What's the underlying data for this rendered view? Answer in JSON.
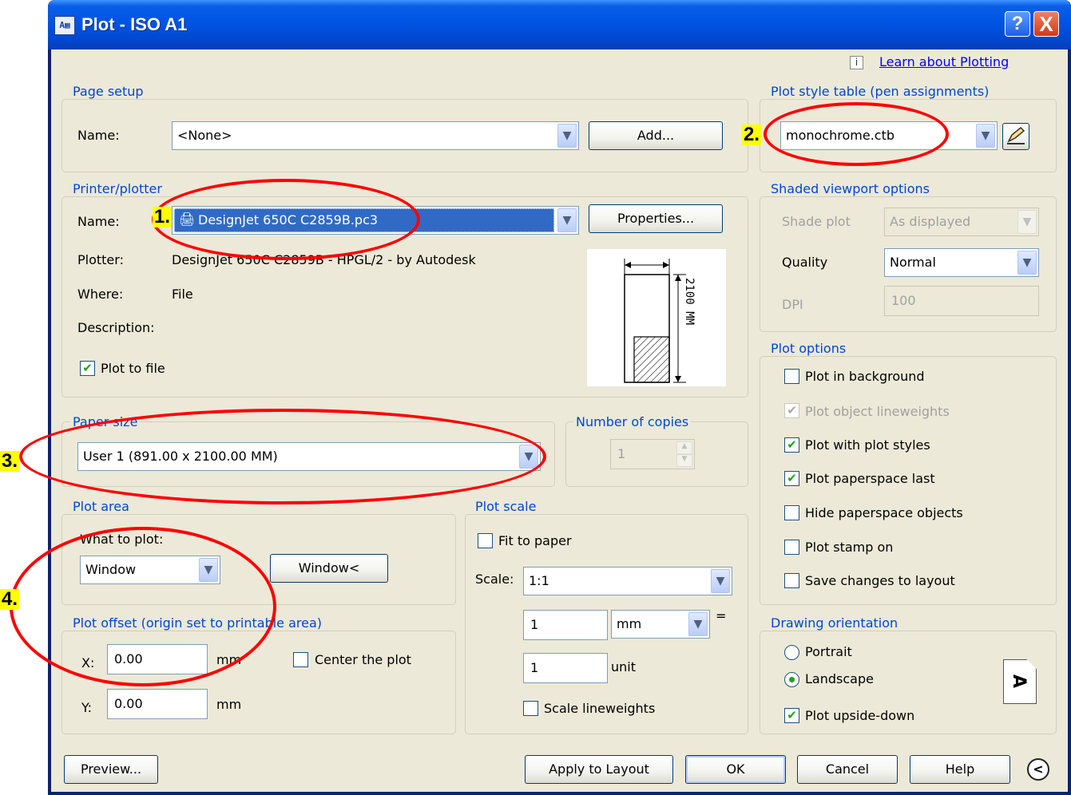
{
  "window": {
    "title": "Plot - ISO A1",
    "help_btn": "?",
    "close_btn": "X",
    "app_icon": "plot-icon"
  },
  "learn": {
    "info_glyph": "i",
    "link": "Learn about Plotting"
  },
  "page_setup": {
    "title": "Page setup",
    "name_label": "Name:",
    "name_value": "<None>",
    "add_button": "Add..."
  },
  "plot_style": {
    "title": "Plot style table (pen assignments)",
    "value": "monochrome.ctb"
  },
  "printer": {
    "title": "Printer/plotter",
    "name_label": "Name:",
    "name_value": "DesignJet 650C C2859B.pc3",
    "properties_button": "Properties...",
    "plotter_label": "Plotter:",
    "plotter_value": "DesignJet 650C C2859B - HPGL/2 - by Autodesk",
    "where_label": "Where:",
    "where_value": "File",
    "description_label": "Description:",
    "plot_to_file": "Plot to file",
    "plot_to_file_checked": true,
    "preview_dimension": "2100 MM"
  },
  "shaded": {
    "title": "Shaded viewport options",
    "shade_plot_label": "Shade plot",
    "shade_plot_value": "As displayed",
    "quality_label": "Quality",
    "quality_value": "Normal",
    "dpi_label": "DPI",
    "dpi_value": "100"
  },
  "plot_options": {
    "title": "Plot options",
    "items": [
      {
        "label": "Plot in background",
        "checked": false,
        "enabled": true
      },
      {
        "label": "Plot object lineweights",
        "checked": true,
        "enabled": false
      },
      {
        "label": "Plot with plot styles",
        "checked": true,
        "enabled": true
      },
      {
        "label": "Plot paperspace last",
        "checked": true,
        "enabled": true
      },
      {
        "label": "Hide paperspace objects",
        "checked": false,
        "enabled": true
      },
      {
        "label": "Plot stamp on",
        "checked": false,
        "enabled": true
      },
      {
        "label": "Save changes to layout",
        "checked": false,
        "enabled": true
      }
    ]
  },
  "paper_size": {
    "title": "Paper size",
    "value": "User 1 (891.00 x 2100.00 MM)"
  },
  "copies": {
    "title": "Number of copies",
    "value": "1"
  },
  "plot_area": {
    "title": "Plot area",
    "what_label": "What to plot:",
    "what_value": "Window",
    "window_button": "Window<"
  },
  "plot_offset": {
    "title": "Plot offset (origin set to printable area)",
    "x_label": "X:",
    "x_value": "0.00",
    "y_label": "Y:",
    "y_value": "0.00",
    "unit": "mm",
    "center_label": "Center the plot"
  },
  "plot_scale": {
    "title": "Plot scale",
    "fit_label": "Fit to paper",
    "scale_label": "Scale:",
    "scale_value": "1:1",
    "value1": "1",
    "unit1": "mm",
    "equals": "=",
    "value2": "1",
    "unit2": "unit",
    "lineweights_label": "Scale lineweights"
  },
  "orientation": {
    "title": "Drawing orientation",
    "portrait": "Portrait",
    "landscape": "Landscape",
    "upside_down": "Plot upside-down",
    "icon_glyph": "A"
  },
  "footer": {
    "preview": "Preview...",
    "apply": "Apply to Layout",
    "ok": "OK",
    "cancel": "Cancel",
    "help": "Help",
    "more_glyph": "<"
  },
  "annotations": {
    "m1": "1.",
    "m2": "2.",
    "m3": "3.",
    "m4": "4.",
    "color": "#ff0000",
    "marker_color": "#ffff00"
  }
}
